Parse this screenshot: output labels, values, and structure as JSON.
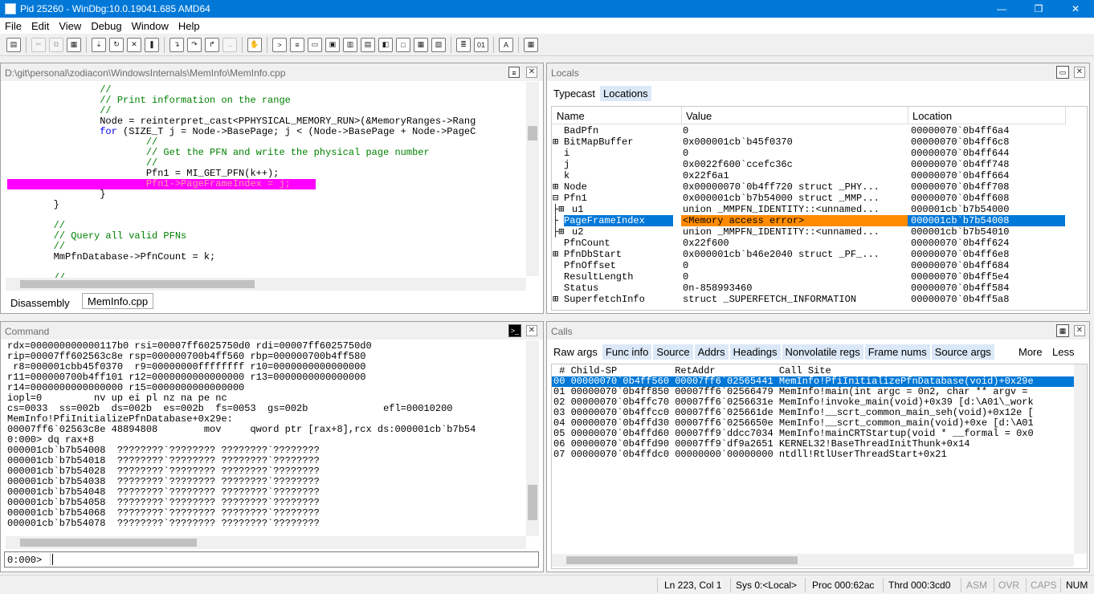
{
  "window": {
    "title": "Pid 25260 - WinDbg:10.0.19041.685 AMD64",
    "minimize": "—",
    "maximize": "❐",
    "close": "✕"
  },
  "menu": [
    "File",
    "Edit",
    "View",
    "Debug",
    "Window",
    "Help"
  ],
  "source": {
    "path": "D:\\git\\personal\\zodiacon\\WindowsInternals\\MemInfo\\MemInfo.cpp",
    "lines": [
      {
        "indent": "                ",
        "parts": [
          {
            "t": "//",
            "c": "cmt"
          }
        ]
      },
      {
        "indent": "                ",
        "parts": [
          {
            "t": "// Print information on the range",
            "c": "cmt"
          }
        ]
      },
      {
        "indent": "                ",
        "parts": [
          {
            "t": "//",
            "c": "cmt"
          }
        ]
      },
      {
        "indent": "                ",
        "parts": [
          {
            "t": "Node = reinterpret_cast<PPHYSICAL_MEMORY_RUN>(&MemoryRanges->Rang",
            "c": ""
          }
        ]
      },
      {
        "indent": "                ",
        "parts": [
          {
            "t": "for",
            "c": "kw"
          },
          {
            "t": " (SIZE_T j = Node->BasePage; j < (Node->BasePage + Node->PageC",
            "c": ""
          }
        ]
      },
      {
        "indent": "                        ",
        "parts": [
          {
            "t": "//",
            "c": "cmt"
          }
        ]
      },
      {
        "indent": "                        ",
        "parts": [
          {
            "t": "// Get the PFN and write the physical page number",
            "c": "cmt"
          }
        ]
      },
      {
        "indent": "                        ",
        "parts": [
          {
            "t": "//",
            "c": "cmt"
          }
        ]
      },
      {
        "indent": "                        ",
        "parts": [
          {
            "t": "Pfn1 = MI_GET_PFN(k++);",
            "c": ""
          }
        ]
      },
      {
        "indent": "                        ",
        "parts": [
          {
            "t": "Pfn1->PageFrameIndex = j;",
            "c": ""
          }
        ],
        "highlight": true
      },
      {
        "indent": "                ",
        "parts": [
          {
            "t": "}",
            "c": ""
          }
        ]
      },
      {
        "indent": "        ",
        "parts": [
          {
            "t": "}",
            "c": ""
          }
        ]
      },
      {
        "indent": "",
        "parts": [
          {
            "t": "",
            "c": ""
          }
        ]
      },
      {
        "indent": "        ",
        "parts": [
          {
            "t": "//",
            "c": "cmt"
          }
        ]
      },
      {
        "indent": "        ",
        "parts": [
          {
            "t": "// Query all valid PFNs",
            "c": "cmt"
          }
        ]
      },
      {
        "indent": "        ",
        "parts": [
          {
            "t": "//",
            "c": "cmt"
          }
        ]
      },
      {
        "indent": "        ",
        "parts": [
          {
            "t": "MmPfnDatabase->PfnCount = k;",
            "c": ""
          }
        ]
      },
      {
        "indent": "",
        "parts": [
          {
            "t": "",
            "c": ""
          }
        ]
      },
      {
        "indent": "        ",
        "parts": [
          {
            "t": "//",
            "c": "cmt"
          }
        ]
      }
    ],
    "tabs": [
      "Disassembly",
      "MemInfo.cpp"
    ]
  },
  "locals": {
    "title": "Locals",
    "tabs": [
      "Typecast",
      "Locations"
    ],
    "columns": [
      "Name",
      "Value",
      "Location"
    ],
    "rows": [
      {
        "exp": "",
        "name": "BadPfn",
        "value": "0",
        "loc": "00000070`0b4ff6a4"
      },
      {
        "exp": "⊞",
        "name": "BitMapBuffer",
        "value": "0x000001cb`b45f0370",
        "loc": "00000070`0b4ff6c8"
      },
      {
        "exp": "",
        "name": "i",
        "value": "0",
        "loc": "00000070`0b4ff644"
      },
      {
        "exp": "",
        "name": "j",
        "value": "0x0022f600`ccefc36c",
        "loc": "00000070`0b4ff748"
      },
      {
        "exp": "",
        "name": "k",
        "value": "0x22f6a1",
        "loc": "00000070`0b4ff664"
      },
      {
        "exp": "⊞",
        "name": "Node",
        "value": "0x00000070`0b4ff720 struct _PHY...",
        "loc": "00000070`0b4ff708"
      },
      {
        "exp": "⊟",
        "name": "Pfn1",
        "value": "0x000001cb`b7b54000 struct _MMP...",
        "loc": "00000070`0b4ff608"
      },
      {
        "exp": "├⊞",
        "name": "u1",
        "value": "union _MMPFN_IDENTITY::<unnamed...",
        "loc": "000001cb`b7b54000"
      },
      {
        "exp": "├",
        "name": "PageFrameIndex",
        "value": "<Memory access error>",
        "loc": "000001cb`b7b54008",
        "selected": true
      },
      {
        "exp": "├⊞",
        "name": "u2",
        "value": "union _MMPFN_IDENTITY::<unnamed...",
        "loc": "000001cb`b7b54010"
      },
      {
        "exp": "",
        "name": "PfnCount",
        "value": "0x22f600",
        "loc": "00000070`0b4ff624"
      },
      {
        "exp": "⊞",
        "name": "PfnDbStart",
        "value": "0x000001cb`b46e2040 struct _PF_...",
        "loc": "00000070`0b4ff6e8"
      },
      {
        "exp": "",
        "name": "PfnOffset",
        "value": "0",
        "loc": "00000070`0b4ff684"
      },
      {
        "exp": "",
        "name": "ResultLength",
        "value": "0",
        "loc": "00000070`0b4ff5e4"
      },
      {
        "exp": "",
        "name": "Status",
        "value": "0n-858993460",
        "loc": "00000070`0b4ff584"
      },
      {
        "exp": "⊞",
        "name": "SuperfetchInfo",
        "value": "struct _SUPERFETCH_INFORMATION",
        "loc": "00000070`0b4ff5a8"
      }
    ]
  },
  "command": {
    "title": "Command",
    "lines": [
      "rdx=000000000000117b0 rsi=00007ff6025750d0 rdi=00007ff6025750d0",
      "rip=00007ff602563c8e rsp=000000700b4ff560 rbp=000000700b4ff580",
      " r8=000001cbb45f0370  r9=00000000ffffffff r10=0000000000000000",
      "r11=000000700b4ff101 r12=0000000000000000 r13=0000000000000000",
      "r14=0000000000000000 r15=0000000000000000",
      "iopl=0         nv up ei pl nz na pe nc",
      "cs=0033  ss=002b  ds=002b  es=002b  fs=0053  gs=002b             efl=00010200",
      "MemInfo!PfiInitializePfnDatabase+0x29e:",
      "00007ff6`02563c8e 48894808        mov     qword ptr [rax+8],rcx ds:000001cb`b7b54",
      "0:000> dq rax+8",
      "000001cb`b7b54008  ????????`???????? ????????`????????",
      "000001cb`b7b54018  ????????`???????? ????????`????????",
      "000001cb`b7b54028  ????????`???????? ????????`????????",
      "000001cb`b7b54038  ????????`???????? ????????`????????",
      "000001cb`b7b54048  ????????`???????? ????????`????????",
      "000001cb`b7b54058  ????????`???????? ????????`????????",
      "000001cb`b7b54068  ????????`???????? ????????`????????",
      "000001cb`b7b54078  ????????`???????? ????????`????????"
    ],
    "prompt": "0:000>"
  },
  "calls": {
    "title": "Calls",
    "tabs": [
      "Raw args",
      "Func info",
      "Source",
      "Addrs",
      "Headings",
      "Nonvolatile regs",
      "Frame nums",
      "Source args"
    ],
    "more": "More",
    "less": "Less",
    "header": " # Child-SP          RetAddr           Call Site",
    "rows": [
      {
        "text": "00 00000070`0b4ff560 00007ff6`02565441 MemInfo!PfiInitializePfnDatabase(void)+0x29e",
        "selected": true
      },
      {
        "text": "01 00000070`0b4ff850 00007ff6`02566479 MemInfo!main(int argc = 0n2, char ** argv = "
      },
      {
        "text": "02 00000070`0b4ffc70 00007ff6`0256631e MemInfo!invoke_main(void)+0x39 [d:\\A01\\_work"
      },
      {
        "text": "03 00000070`0b4ffcc0 00007ff6`025661de MemInfo!__scrt_common_main_seh(void)+0x12e ["
      },
      {
        "text": "04 00000070`0b4ffd30 00007ff6`0256650e MemInfo!__scrt_common_main(void)+0xe [d:\\A01"
      },
      {
        "text": "05 00000070`0b4ffd60 00007ff9`ddcc7034 MemInfo!mainCRTStartup(void * __formal = 0x0"
      },
      {
        "text": "06 00000070`0b4ffd90 00007ff9`df9a2651 KERNEL32!BaseThreadInitThunk+0x14"
      },
      {
        "text": "07 00000070`0b4ffdc0 00000000`00000000 ntdll!RtlUserThreadStart+0x21"
      }
    ]
  },
  "status": {
    "pos": "Ln 223, Col 1",
    "sys": "Sys 0:<Local>",
    "proc": "Proc 000:62ac",
    "thrd": "Thrd 000:3cd0",
    "asm": "ASM",
    "ovr": "OVR",
    "caps": "CAPS",
    "num": "NUM"
  },
  "colors": {
    "highlight": "#ff00ff",
    "selection": "#0078d7",
    "error_bg": "#ff8c00",
    "comment": "#008000",
    "keyword": "#0000ff"
  }
}
